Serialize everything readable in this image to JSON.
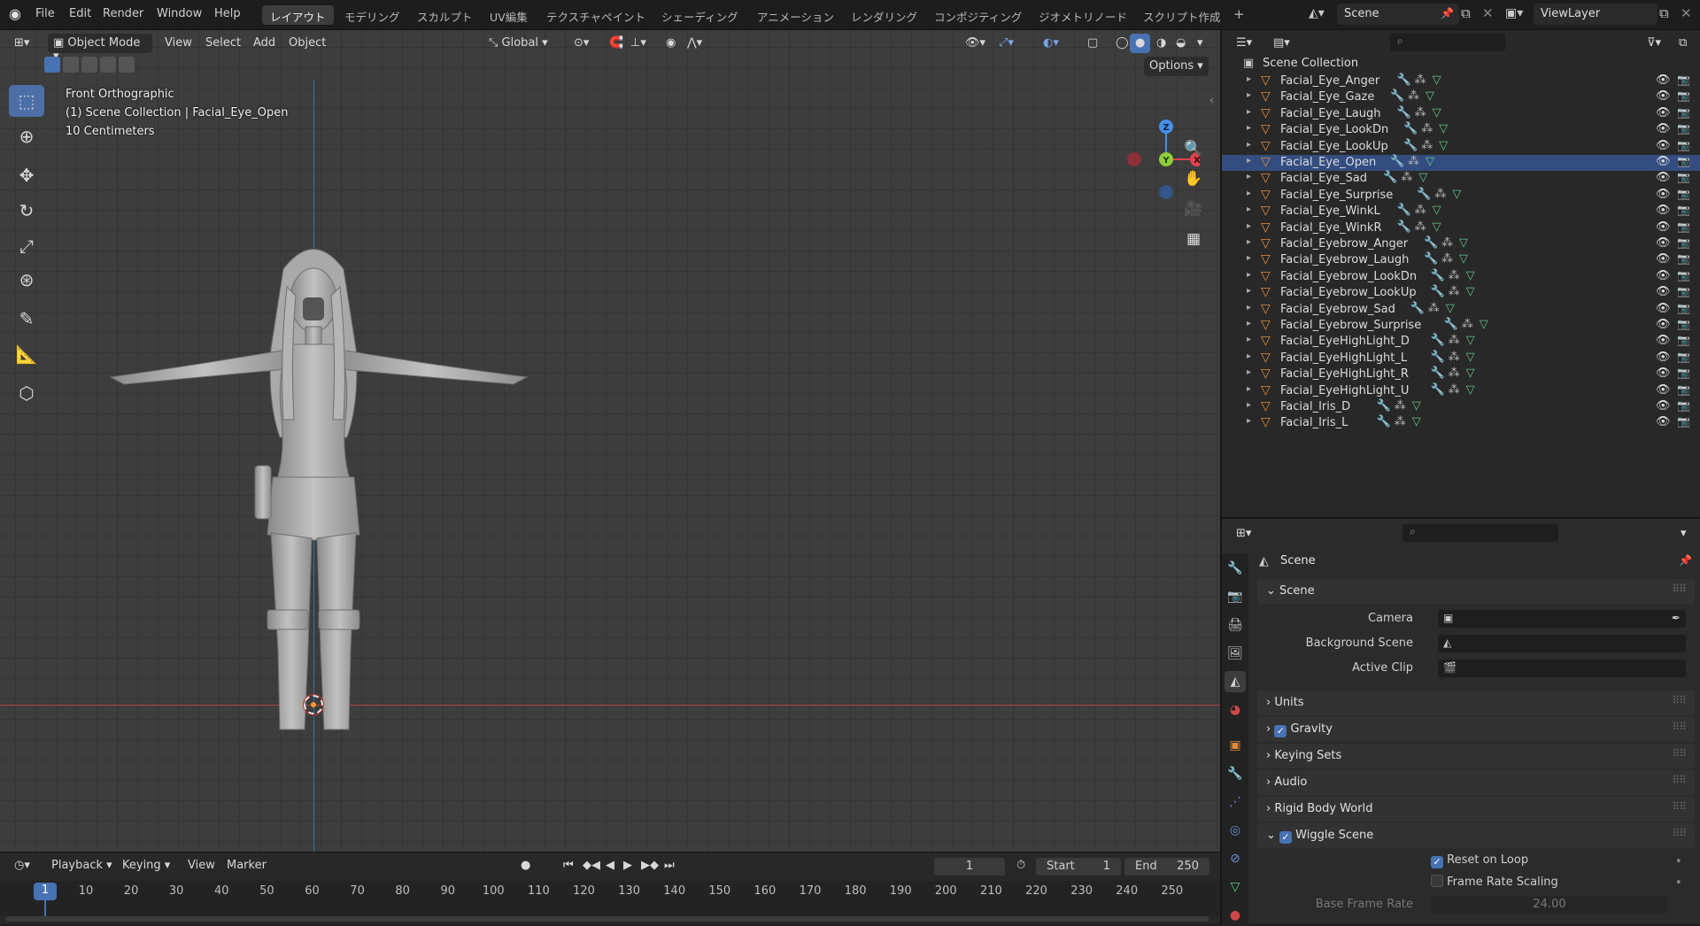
{
  "menubar": {
    "items": [
      "File",
      "Edit",
      "Render",
      "Window",
      "Help"
    ],
    "workspaces": [
      "レイアウト",
      "モデリング",
      "スカルプト",
      "UV編集",
      "テクスチャペイント",
      "シェーディング",
      "アニメーション",
      "レンダリング",
      "コンポジティング",
      "ジオメトリノード",
      "スクリプト作成"
    ],
    "active_workspace": "レイアウト",
    "add_tab": "+",
    "scene_name": "Scene",
    "view_layer": "ViewLayer"
  },
  "viewport": {
    "mode": "Object Mode",
    "menus": [
      "View",
      "Select",
      "Add",
      "Object"
    ],
    "transform_orientation": "Global",
    "options_label": "Options",
    "overlay_lines": [
      "Front Orthographic",
      "(1) Scene Collection | Facial_Eye_Open",
      "10 Centimeters"
    ],
    "gizmo_axes": {
      "z": "Z",
      "y": "Y",
      "x": "X"
    },
    "tools": [
      "select-box",
      "cursor",
      "move",
      "rotate",
      "scale",
      "transform",
      "annotate",
      "measure",
      "add-cube"
    ]
  },
  "timeline": {
    "menus": [
      "Playback",
      "Keying",
      "View",
      "Marker"
    ],
    "current_frame": "1",
    "start_label": "Start",
    "start": "1",
    "end_label": "End",
    "end": "250",
    "ticks": [
      "1",
      "10",
      "20",
      "30",
      "40",
      "50",
      "60",
      "70",
      "80",
      "90",
      "100",
      "110",
      "120",
      "130",
      "140",
      "150",
      "160",
      "170",
      "180",
      "190",
      "200",
      "210",
      "220",
      "230",
      "240",
      "250"
    ]
  },
  "outliner": {
    "root": "Scene Collection",
    "selected": "Facial_Eye_Open",
    "items": [
      "Facial_Eye_Anger",
      "Facial_Eye_Gaze",
      "Facial_Eye_Laugh",
      "Facial_Eye_LookDn",
      "Facial_Eye_LookUp",
      "Facial_Eye_Open",
      "Facial_Eye_Sad",
      "Facial_Eye_Surprise",
      "Facial_Eye_WinkL",
      "Facial_Eye_WinkR",
      "Facial_Eyebrow_Anger",
      "Facial_Eyebrow_Laugh",
      "Facial_Eyebrow_LookDn",
      "Facial_Eyebrow_LookUp",
      "Facial_Eyebrow_Sad",
      "Facial_Eyebrow_Surprise",
      "Facial_EyeHighLight_D",
      "Facial_EyeHighLight_L",
      "Facial_EyeHighLight_R",
      "Facial_EyeHighLight_U",
      "Facial_Iris_D",
      "Facial_Iris_L"
    ]
  },
  "properties": {
    "context": "Scene",
    "panel_title": "Scene",
    "scene_fields": [
      {
        "label": "Camera"
      },
      {
        "label": "Background Scene"
      },
      {
        "label": "Active Clip"
      }
    ],
    "sections": [
      {
        "label": "Units",
        "checkbox": false
      },
      {
        "label": "Gravity",
        "checkbox": true
      },
      {
        "label": "Keying Sets",
        "checkbox": false
      },
      {
        "label": "Audio",
        "checkbox": false
      },
      {
        "label": "Rigid Body World",
        "checkbox": false
      },
      {
        "label": "Wiggle Scene",
        "checkbox": true,
        "expanded": true
      }
    ],
    "wiggle": {
      "reset_on_loop": "Reset on Loop",
      "frame_rate_scaling": "Frame Rate Scaling",
      "base_frame_rate_label": "Base Frame Rate",
      "base_frame_rate": "24.00"
    }
  },
  "colors": {
    "accent": "#4772b3",
    "selection": "#334d80",
    "object_icon": "#e08a3c",
    "modifier_icon": "#6d8fd4",
    "mesh_icon": "#63c58a",
    "axis_x": "#e0434f",
    "axis_y": "#8fcf3b",
    "axis_z": "#4690e6"
  }
}
